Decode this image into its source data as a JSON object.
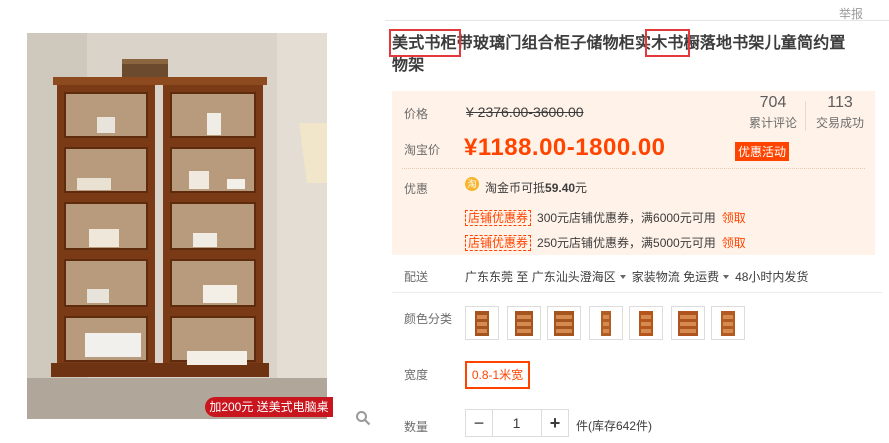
{
  "header": {
    "report_label": "举报"
  },
  "product": {
    "title_line1": "美式书柜带玻璃门组合柜子储物柜实木书橱落地书架儿童简约置",
    "title_line2": "物架",
    "promo_tag": "加200元 送美式电脑桌"
  },
  "price": {
    "label": "价格",
    "original": "¥ 2376.00-3600.00",
    "taobao_label": "淘宝价",
    "current": "¥1188.00-1800.00",
    "badge": "优惠活动",
    "reviews_count": "704",
    "reviews_label": "累计评论",
    "sales_count": "113",
    "sales_label": "交易成功"
  },
  "discount": {
    "label": "优惠",
    "coin_icon_text": "淘",
    "coin_text": "淘金币可抵",
    "coin_amount": "59.40",
    "coin_unit": "元",
    "coupons": [
      {
        "tag": "店铺优惠券",
        "desc": "300元店铺优惠券，满6000元可用",
        "action": "领取"
      },
      {
        "tag": "店铺优惠券",
        "desc": "250元店铺优惠券，满5000元可用",
        "action": "领取"
      }
    ]
  },
  "shipping": {
    "label": "配送",
    "from": "广东东莞",
    "to_word": "至",
    "dest": "广东汕头澄海区",
    "method": "家装物流 免运费",
    "time": "48小时内发货"
  },
  "color": {
    "label": "颜色分类",
    "swatch_count": 7
  },
  "width": {
    "label": "宽度",
    "selected": "0.8-1米宽"
  },
  "quantity": {
    "label": "数量",
    "minus": "−",
    "value": "1",
    "plus": "+",
    "unit_stock": "件(库存642件)"
  },
  "colors": {
    "accent": "#ff4400",
    "highlight_box": "#e4393c",
    "price_bg": "#fff2e8"
  }
}
